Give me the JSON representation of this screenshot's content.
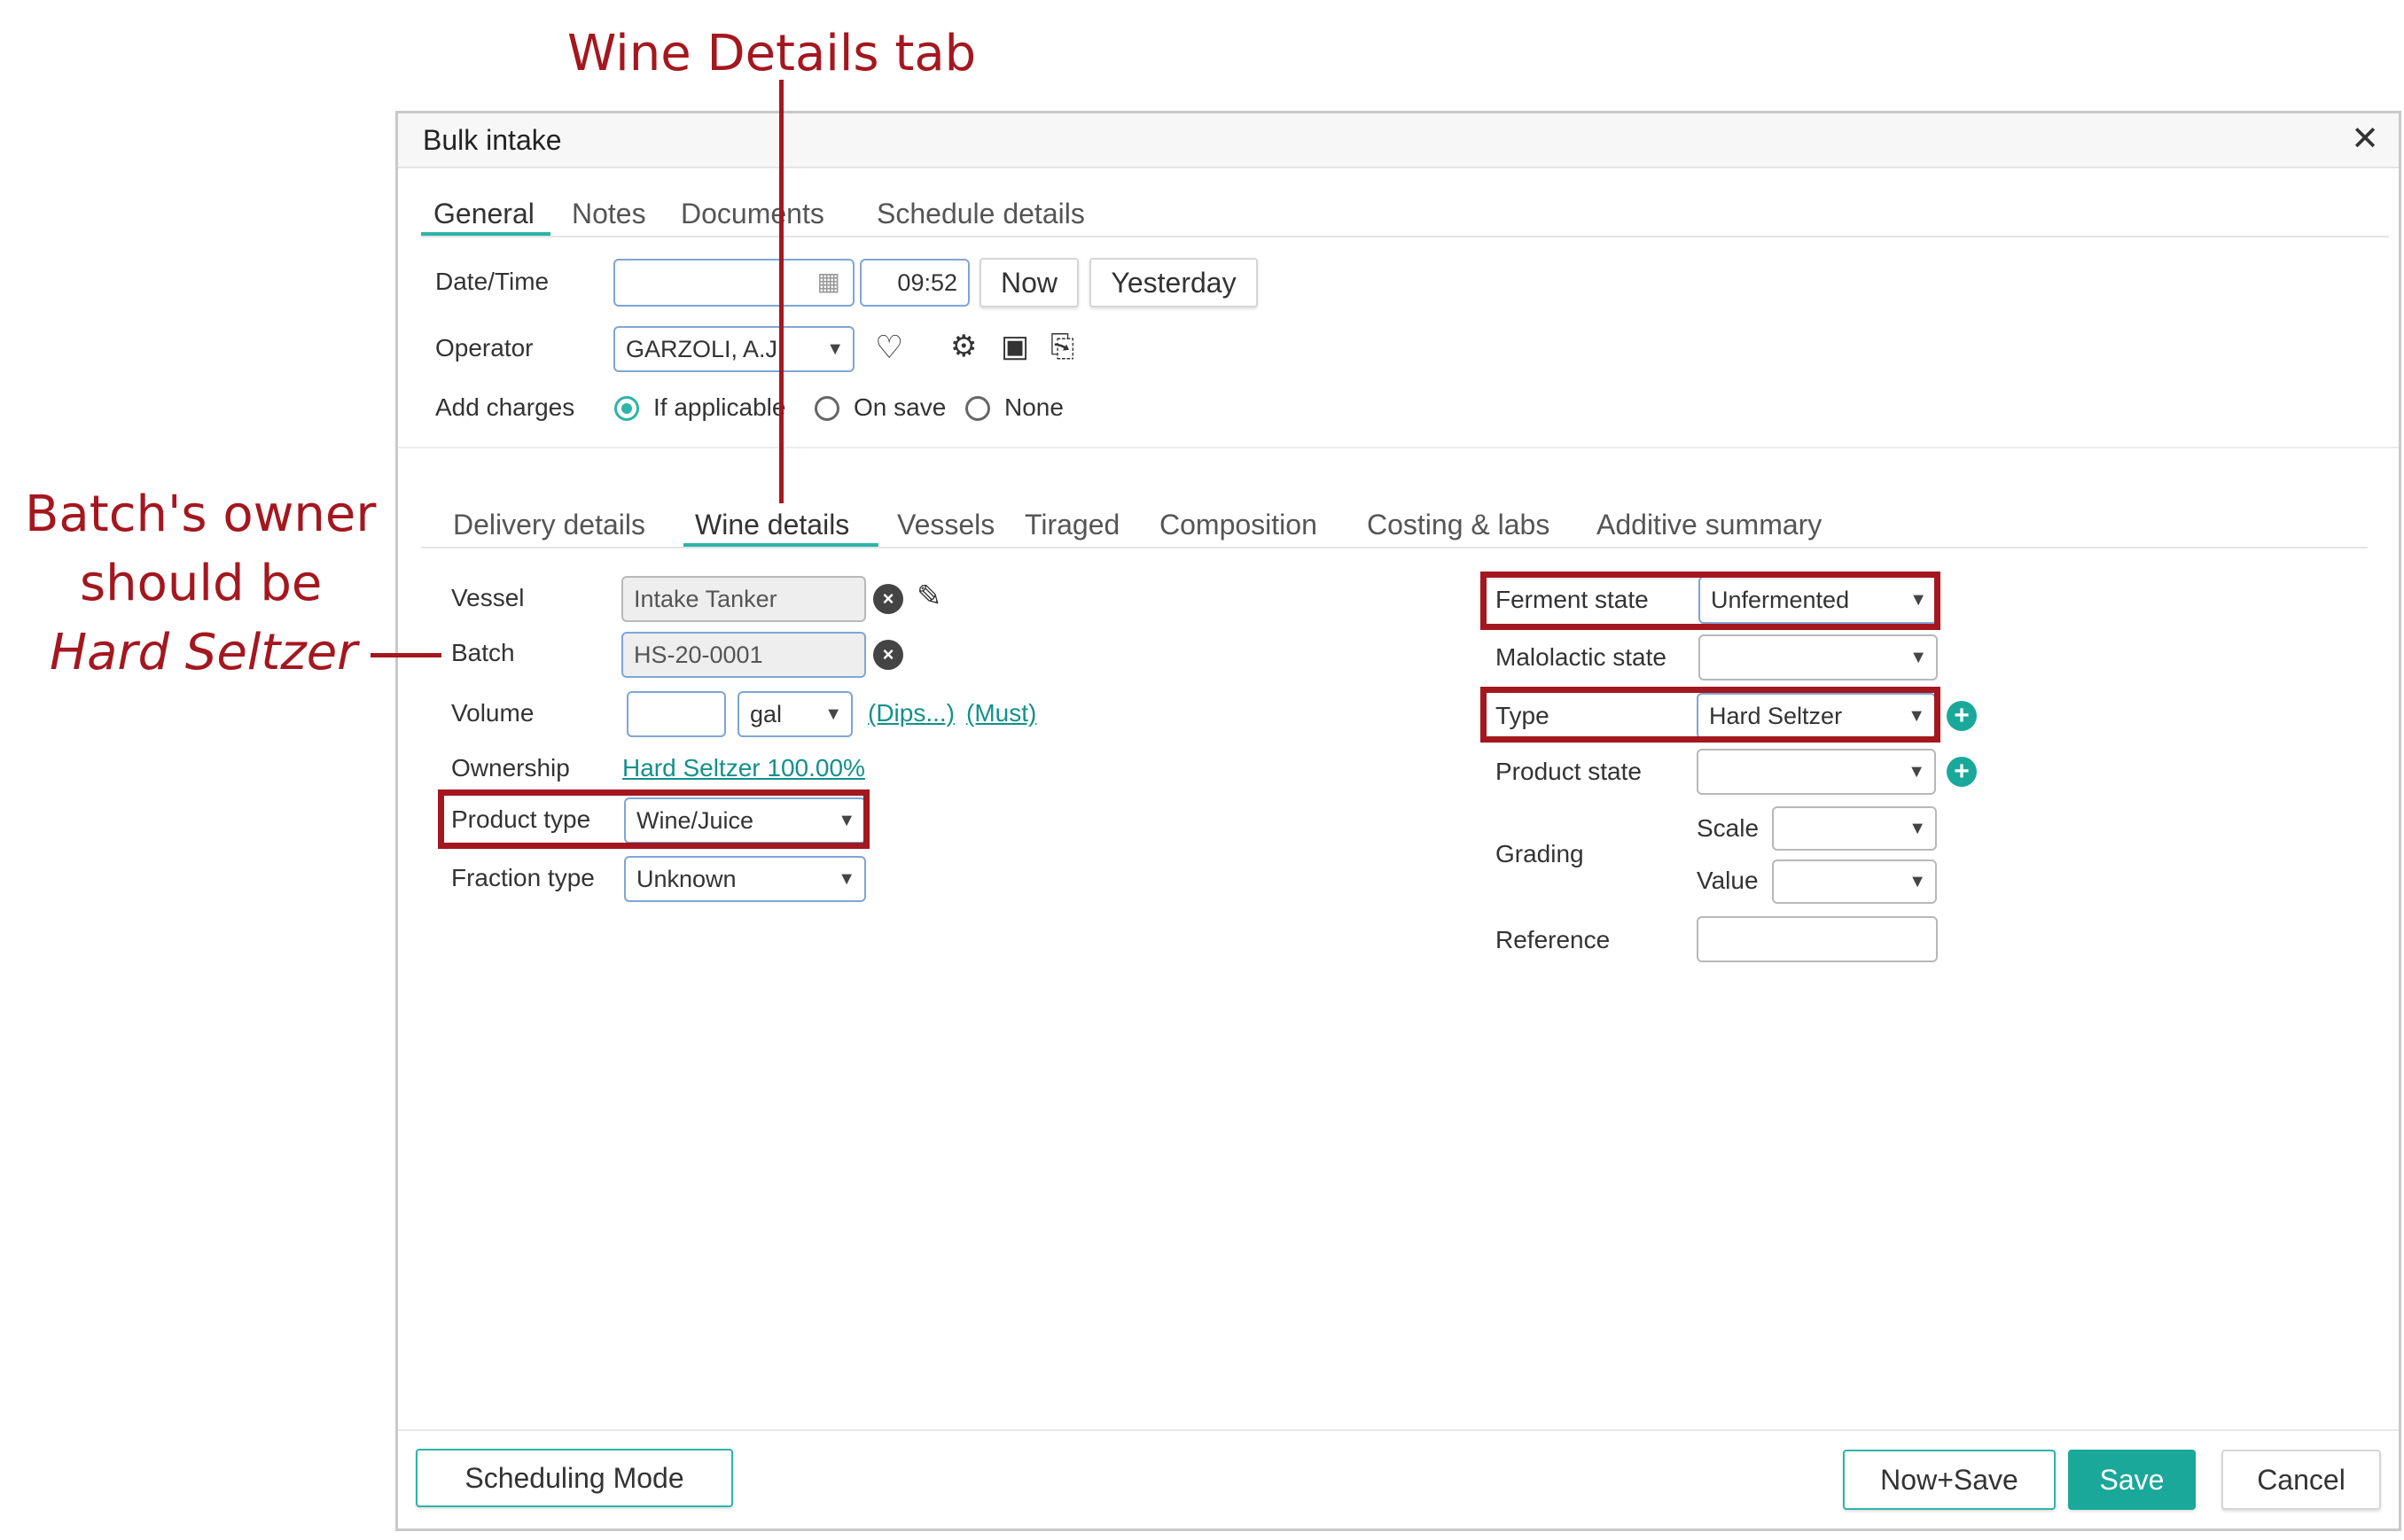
{
  "annotations": {
    "wine_details_tab": "Wine Details tab",
    "batch_owner_line1": "Batch's owner",
    "batch_owner_line2": "should be",
    "batch_owner_line3": "Hard Seltzer"
  },
  "dialog": {
    "title": "Bulk intake",
    "close_glyph": "✕",
    "top_tabs": [
      "General",
      "Notes",
      "Documents",
      "Schedule details"
    ],
    "date_time": {
      "label": "Date/Time",
      "date_value": "",
      "time_value": "09:52",
      "now_label": "Now",
      "yesterday_label": "Yesterday"
    },
    "operator": {
      "label": "Operator",
      "value": "GARZOLI, A.J."
    },
    "add_charges": {
      "label": "Add charges",
      "options": [
        "If applicable",
        "On save",
        "None"
      ],
      "selected": "If applicable"
    },
    "sub_tabs": [
      "Delivery details",
      "Wine details",
      "Vessels",
      "Tiraged",
      "Composition",
      "Costing & labs",
      "Additive summary"
    ],
    "left": {
      "vessel": {
        "label": "Vessel",
        "value": "Intake Tanker"
      },
      "batch": {
        "label": "Batch",
        "value": "HS-20-0001"
      },
      "volume": {
        "label": "Volume",
        "value": "",
        "unit": "gal",
        "dips_link": "(Dips...)",
        "must_link": "(Must)"
      },
      "ownership": {
        "label": "Ownership",
        "value": "Hard Seltzer 100.00%"
      },
      "product_type": {
        "label": "Product type",
        "value": "Wine/Juice"
      },
      "fraction_type": {
        "label": "Fraction type",
        "value": "Unknown"
      }
    },
    "right": {
      "ferment_state": {
        "label": "Ferment state",
        "value": "Unfermented"
      },
      "malolactic_state": {
        "label": "Malolactic state",
        "value": ""
      },
      "type": {
        "label": "Type",
        "value": "Hard Seltzer"
      },
      "product_state": {
        "label": "Product state",
        "value": ""
      },
      "grading": {
        "label": "Grading",
        "scale_label": "Scale",
        "scale_value": "",
        "value_label": "Value",
        "value_value": ""
      },
      "reference": {
        "label": "Reference",
        "value": ""
      }
    },
    "footer": {
      "scheduling_mode": "Scheduling Mode",
      "now_save": "Now+Save",
      "save": "Save",
      "cancel": "Cancel"
    }
  },
  "colors": {
    "accent": "#1aa89a",
    "annotation": "#a4171f"
  }
}
